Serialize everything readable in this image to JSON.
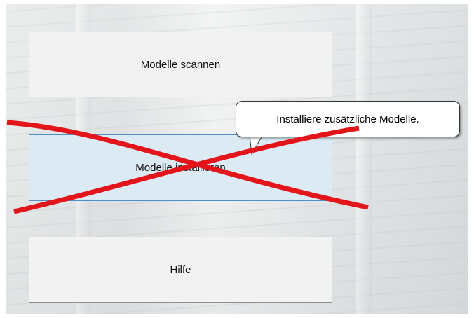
{
  "buttons": {
    "scan_label": "Modelle scannen",
    "install_label": "Modelle installieren",
    "help_label": "Hilfe"
  },
  "tooltip": {
    "text": "Installiere zusätzliche Modelle."
  },
  "colors": {
    "cross": "#e3151a",
    "hover_fill": "#dceaf3",
    "hover_border": "#4f8fc6"
  },
  "annotation": {
    "type": "red-cross",
    "target": "install-button"
  }
}
